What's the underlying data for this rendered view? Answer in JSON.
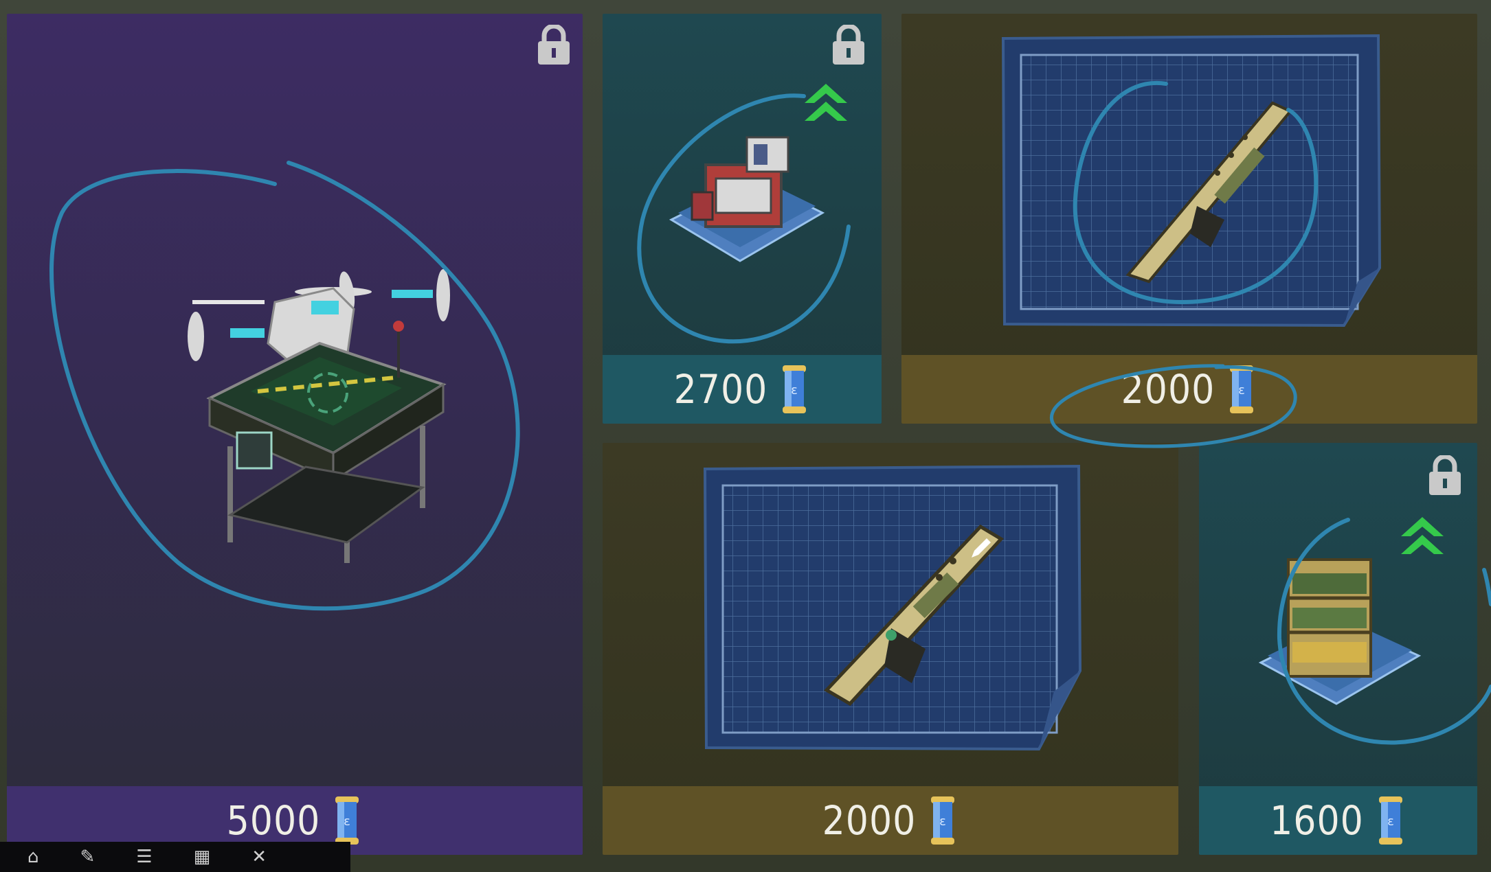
{
  "shop": {
    "items": [
      {
        "name": "drone-station",
        "price": "5000",
        "locked": true,
        "upgrade": false,
        "theme": "purple",
        "currency_icon": "blueprint-scroll-icon"
      },
      {
        "name": "workbench-kit",
        "price": "2700",
        "locked": true,
        "upgrade": true,
        "theme": "teal",
        "currency_icon": "blueprint-scroll-icon"
      },
      {
        "name": "shotgun-blueprint",
        "price": "2000",
        "locked": false,
        "upgrade": false,
        "theme": "olive",
        "currency_icon": "blueprint-scroll-icon"
      },
      {
        "name": "rifle-blueprint",
        "price": "2000",
        "locked": false,
        "upgrade": false,
        "theme": "olive",
        "currency_icon": "blueprint-scroll-icon"
      },
      {
        "name": "shelf-kit",
        "price": "1600",
        "locked": true,
        "upgrade": true,
        "theme": "teal",
        "currency_icon": "blueprint-scroll-icon"
      }
    ]
  },
  "colors": {
    "annotation": "#2f86b0",
    "upgrade": "#35c94b",
    "price_text": "#f0efe6"
  },
  "taskbar": {
    "icons": [
      "home-icon",
      "pen-icon",
      "list-icon",
      "grid-icon",
      "close-icon"
    ]
  }
}
